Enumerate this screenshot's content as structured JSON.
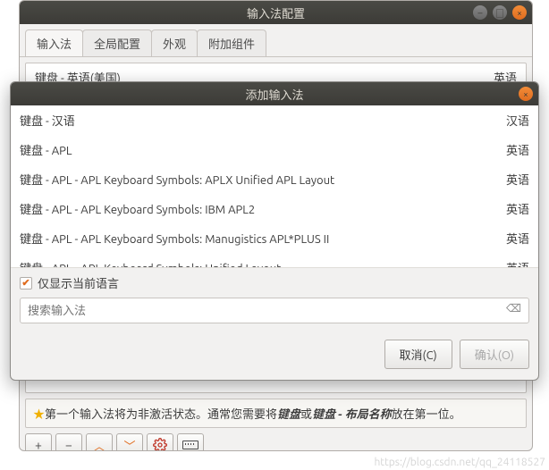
{
  "parent": {
    "title": "输入法配置",
    "tabs": [
      "输入法",
      "全局配置",
      "外观",
      "附加组件"
    ],
    "installed": {
      "name": "键盘 - 英语(美国)",
      "lang": "英语"
    },
    "hint_prefix": "第一个输入法将为非激活状态。通常您需要将",
    "hint_b1": "键盘",
    "hint_or": "或",
    "hint_b2": "键盘 - 布局名称",
    "hint_suffix": "放在第一位。",
    "tool_plus": "+",
    "tool_minus": "−",
    "tool_up": "︿",
    "tool_down": "﹀"
  },
  "dialog": {
    "title": "添加输入法",
    "rows": [
      {
        "name": "键盘 - 汉语",
        "lang": "汉语"
      },
      {
        "name": "键盘 - APL",
        "lang": "英语"
      },
      {
        "name": "键盘 - APL - APL Keyboard Symbols: APLX Unified APL Layout",
        "lang": "英语"
      },
      {
        "name": "键盘 - APL - APL Keyboard Symbols: IBM APL2",
        "lang": "英语"
      },
      {
        "name": "键盘 - APL - APL Keyboard Symbols: Manugistics APL*PLUS II",
        "lang": "英语"
      },
      {
        "name": "键盘 - APL - APL Keyboard Symbols: Unified Layout",
        "lang": "英语"
      }
    ],
    "only_current_lang": "仅显示当前语言",
    "search_placeholder": "搜索输入法",
    "cancel": "取消(C)",
    "ok": "确认(O)"
  },
  "watermark": "https://blog.csdn.net/qq_24118527"
}
